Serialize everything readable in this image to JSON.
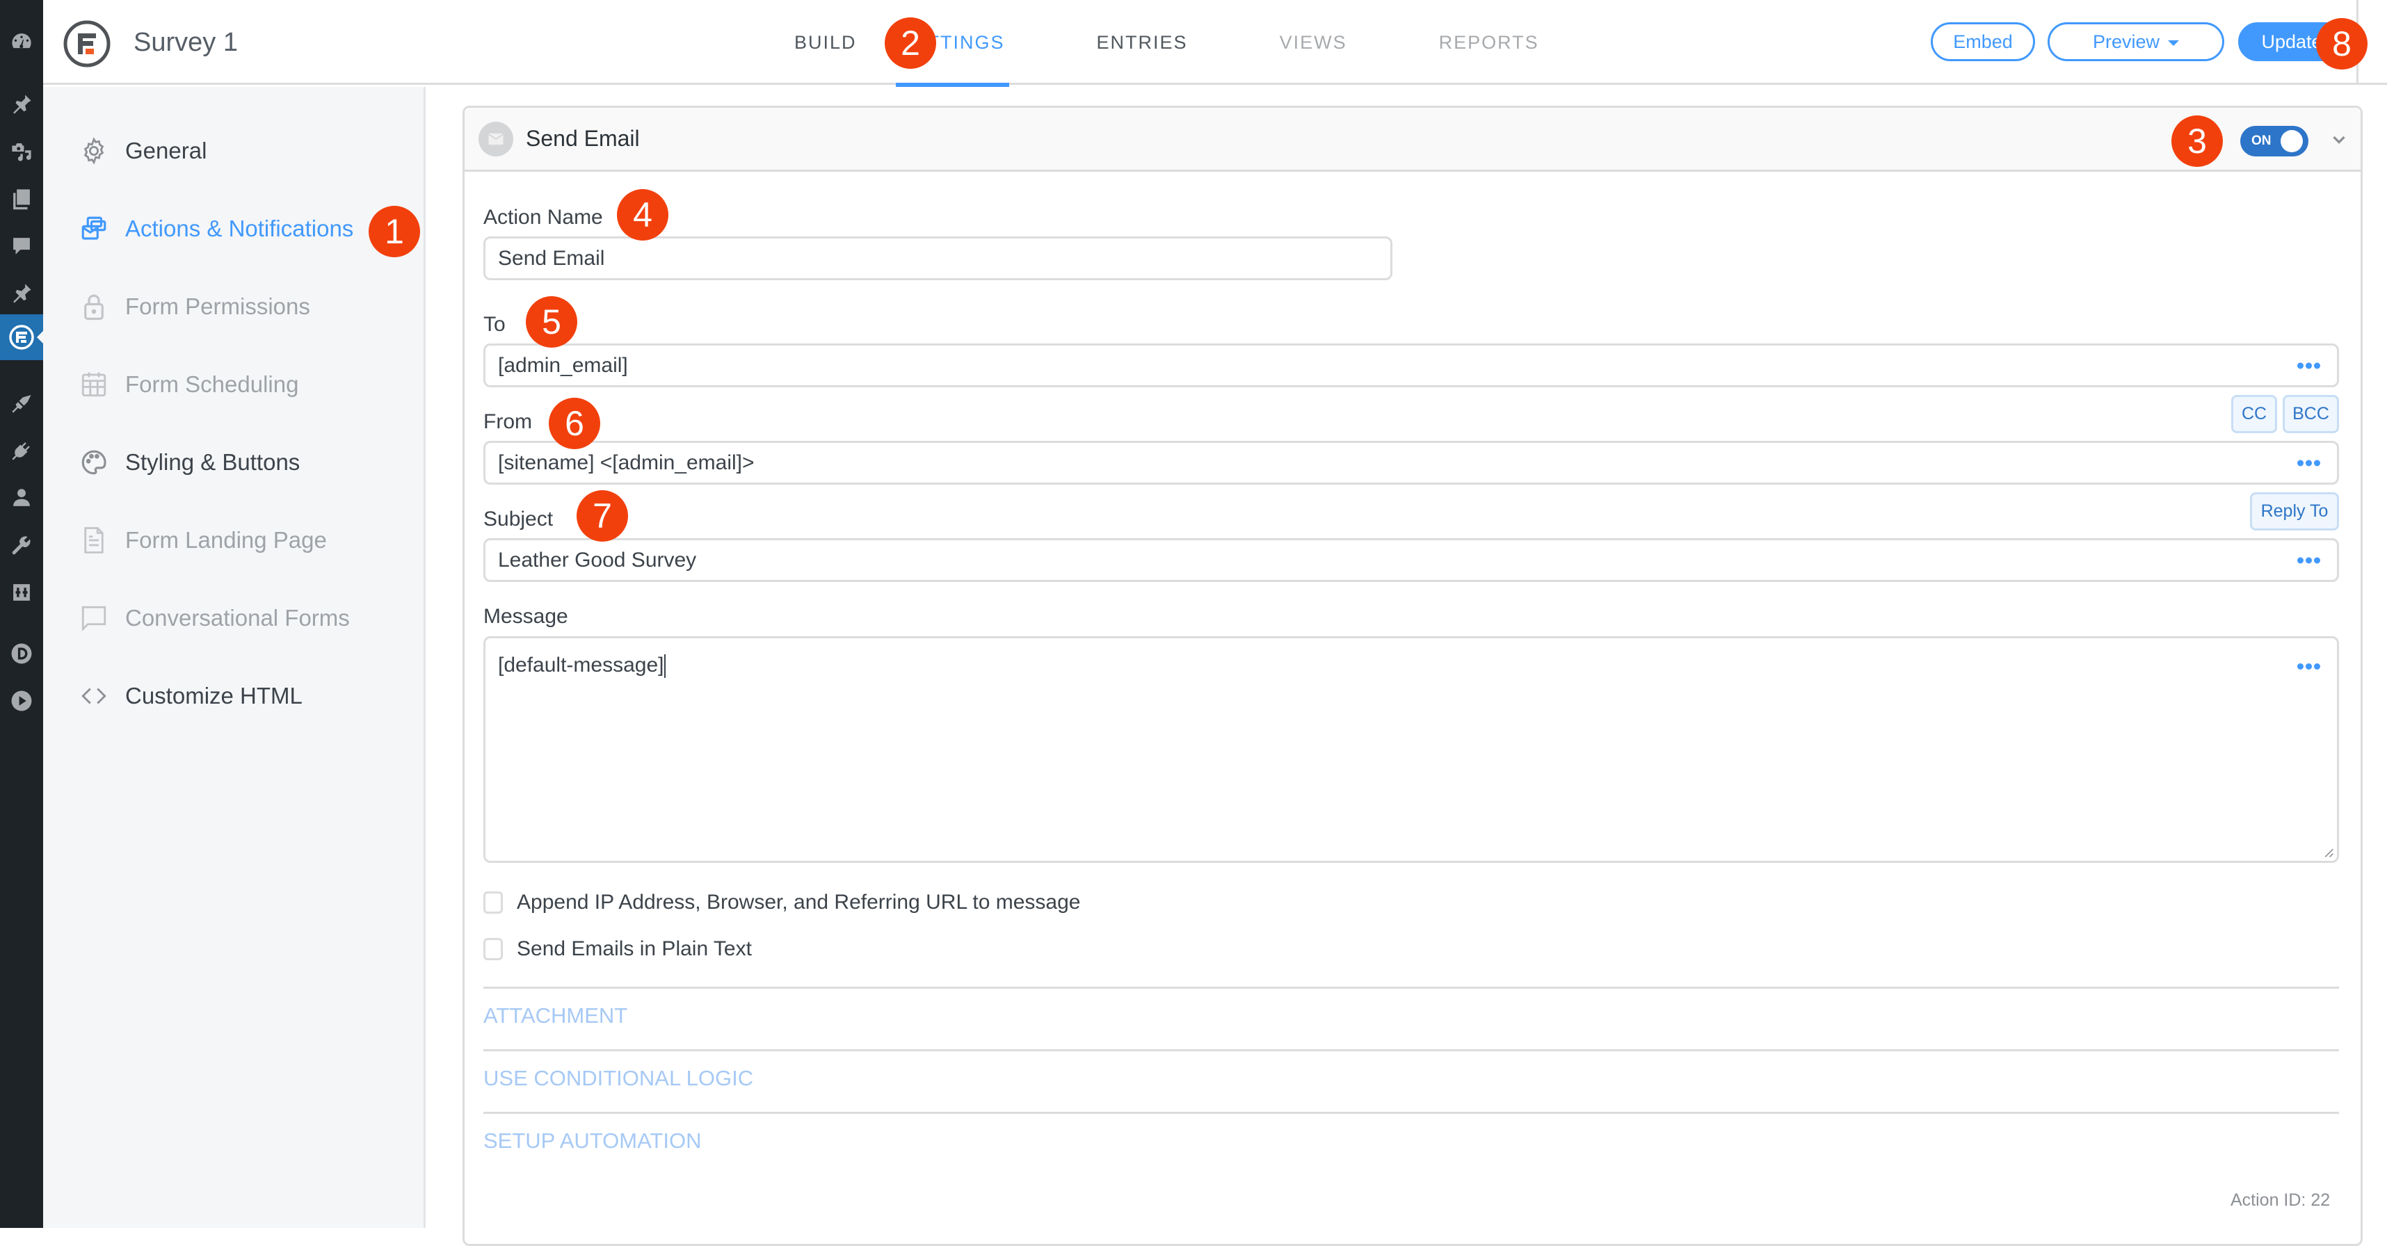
{
  "app": {
    "form_title": "Survey 1"
  },
  "header": {
    "tabs": [
      {
        "label": "BUILD",
        "active": false
      },
      {
        "label": "SETTINGS",
        "active": true
      },
      {
        "label": "ENTRIES",
        "active": false
      },
      {
        "label": "VIEWS",
        "active": false
      },
      {
        "label": "REPORTS",
        "active": false
      }
    ],
    "buttons": {
      "embed": "Embed",
      "preview": "Preview",
      "update": "Update"
    }
  },
  "wp_admin_menu": {
    "icons": [
      "dashboard-icon",
      "posts-pin-icon",
      "media-icon",
      "pages-icon",
      "comments-icon",
      "pin-icon",
      "formidable-icon",
      "appearance-brush-icon",
      "plugins-icon",
      "users-icon",
      "tools-wrench-icon",
      "settings-sliders-icon",
      "divi-d-icon",
      "play-icon"
    ],
    "active": "formidable-icon"
  },
  "settings_nav": {
    "items": [
      {
        "label": "General",
        "icon": "gear-icon",
        "state": "normal"
      },
      {
        "label": "Actions & Notifications",
        "icon": "envelope-stack-icon",
        "state": "active"
      },
      {
        "label": "Form Permissions",
        "icon": "lock-icon",
        "state": "muted"
      },
      {
        "label": "Form Scheduling",
        "icon": "calendar-icon",
        "state": "muted"
      },
      {
        "label": "Styling & Buttons",
        "icon": "palette-icon",
        "state": "normal"
      },
      {
        "label": "Form Landing Page",
        "icon": "document-icon",
        "state": "muted"
      },
      {
        "label": "Conversational Forms",
        "icon": "speech-bubble-icon",
        "state": "muted"
      },
      {
        "label": "Customize HTML",
        "icon": "code-brackets-icon",
        "state": "normal"
      }
    ]
  },
  "action": {
    "title": "Send Email",
    "toggle_label": "ON",
    "toggle_on": true,
    "fields": {
      "action_name": {
        "label": "Action Name",
        "value": "Send Email"
      },
      "to": {
        "label": "To",
        "value": "[admin_email]"
      },
      "from": {
        "label": "From",
        "value": "[sitename] <[admin_email]>"
      },
      "subject": {
        "label": "Subject",
        "value": "Leather Good Survey"
      },
      "message": {
        "label": "Message",
        "value": "[default-message]"
      }
    },
    "extra_buttons": {
      "cc": "CC",
      "bcc": "BCC",
      "reply_to": "Reply To"
    },
    "checkboxes": [
      {
        "label": "Append IP Address, Browser, and Referring URL to message",
        "checked": false
      },
      {
        "label": "Send Emails in Plain Text",
        "checked": false
      }
    ],
    "sections": [
      "ATTACHMENT",
      "USE CONDITIONAL LOGIC",
      "SETUP AUTOMATION"
    ],
    "action_id": "Action ID: 22"
  },
  "annotations": [
    "1",
    "2",
    "3",
    "4",
    "5",
    "6",
    "7",
    "8"
  ],
  "colors": {
    "accent": "#4199fd",
    "toggle_on": "#2d75c8",
    "annotation": "#f2400d",
    "wp_admin_bg": "#1d2327",
    "wp_admin_active": "#2271b1"
  }
}
